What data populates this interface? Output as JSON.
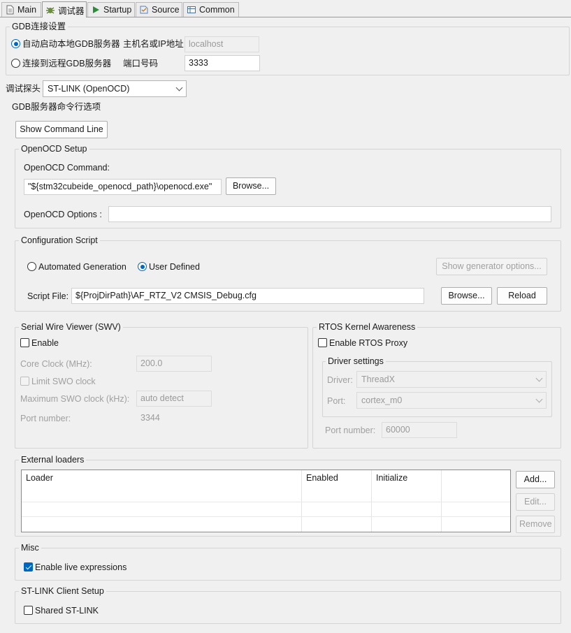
{
  "tabs": [
    {
      "label": "Main",
      "icon": "document-icon"
    },
    {
      "label": "调试器",
      "icon": "debug-bug-icon",
      "active": true
    },
    {
      "label": "Startup",
      "icon": "play-icon"
    },
    {
      "label": "Source",
      "icon": "source-icon"
    },
    {
      "label": "Common",
      "icon": "table-icon"
    }
  ],
  "gdb": {
    "title": "GDB连接设置",
    "auto_label": "自动启动本地GDB服务器",
    "remote_label": "连接到远程GDB服务器",
    "host_label": "主机名或IP地址",
    "host_value": "localhost",
    "port_label": "端口号码",
    "port_value": "3333"
  },
  "probe": {
    "label": "调试探头",
    "value": "ST-LINK (OpenOCD)"
  },
  "server": {
    "title": "GDB服务器命令行选项",
    "show_cmd_button": "Show Command Line"
  },
  "openocd": {
    "title": "OpenOCD Setup",
    "command_label": "OpenOCD Command:",
    "command_value": "\"${stm32cubeide_openocd_path}\\openocd.exe\"",
    "browse_button": "Browse...",
    "options_label": "OpenOCD Options :",
    "options_value": ""
  },
  "config": {
    "title": "Configuration Script",
    "auto_label": "Automated Generation",
    "user_label": "User Defined",
    "generator_button": "Show generator options...",
    "script_label": "Script File:",
    "script_value": "${ProjDirPath}\\AF_RTZ_V2 CMSIS_Debug.cfg",
    "browse_button": "Browse...",
    "reload_button": "Reload"
  },
  "swv": {
    "title": "Serial Wire Viewer (SWV)",
    "enable_label": "Enable",
    "core_clock_label": "Core Clock (MHz):",
    "core_clock_value": "200.0",
    "limit_label": "Limit SWO clock",
    "max_clock_label": "Maximum SWO clock (kHz):",
    "max_clock_value": "auto detect",
    "port_label": "Port number:",
    "port_value": "3344"
  },
  "rtos": {
    "title": "RTOS Kernel Awareness",
    "enable_label": "Enable RTOS Proxy",
    "driver_title": "Driver settings",
    "driver_label": "Driver:",
    "driver_value": "ThreadX",
    "port_label": "Port:",
    "port_value": "cortex_m0",
    "port_number_label": "Port number:",
    "port_number_value": "60000"
  },
  "loaders": {
    "title": "External loaders",
    "columns": [
      "Loader",
      "Enabled",
      "Initialize"
    ],
    "add_button": "Add...",
    "edit_button": "Edit...",
    "remove_button": "Remove"
  },
  "misc": {
    "title": "Misc",
    "live_label": "Enable live expressions"
  },
  "stlink": {
    "title": "ST-LINK Client Setup",
    "shared_label": "Shared ST-LINK"
  },
  "colors": {
    "accent": "#0067c0",
    "disabled_text": "#a0a0a0"
  }
}
